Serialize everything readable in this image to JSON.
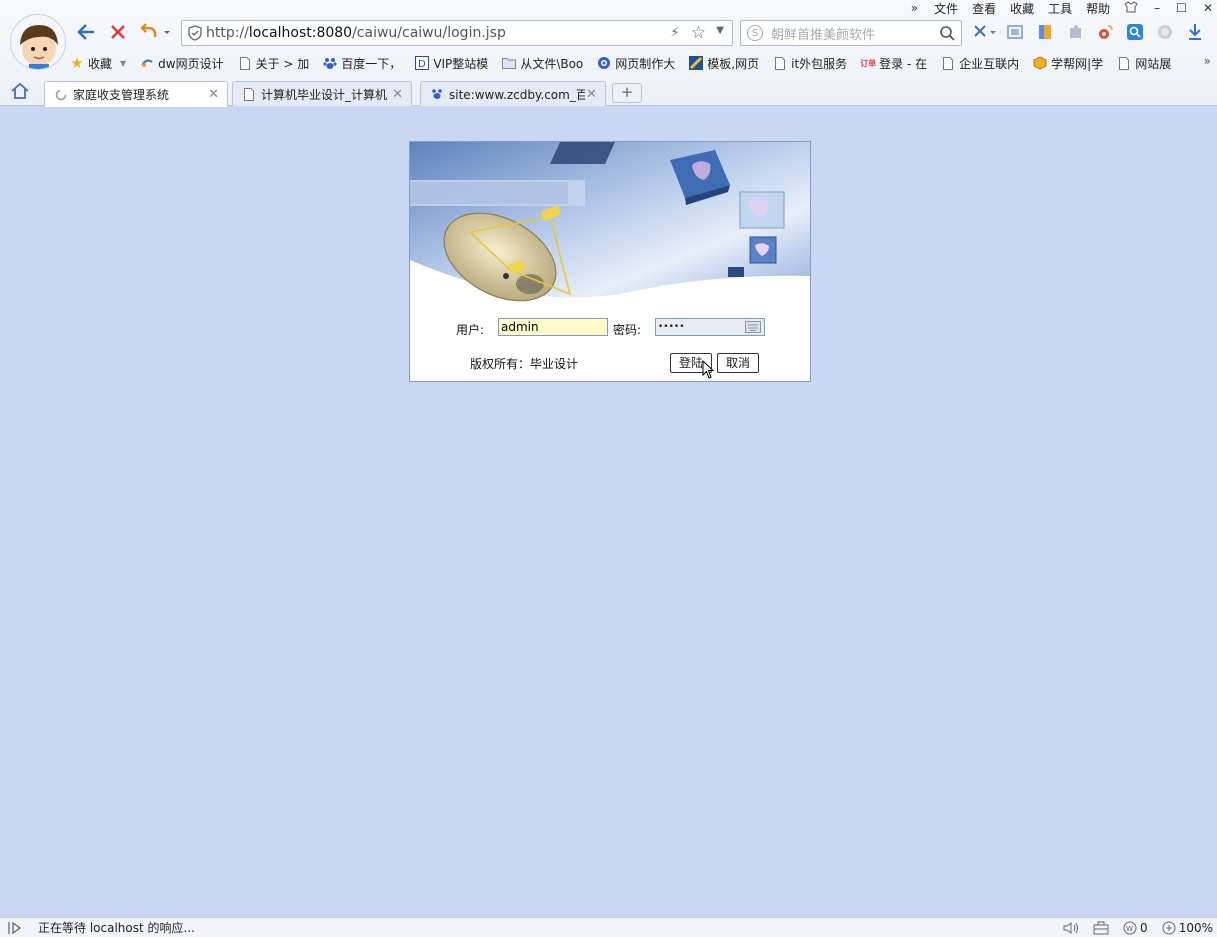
{
  "browser": {
    "menu": [
      "文件",
      "查看",
      "收藏",
      "工具",
      "帮助"
    ],
    "address": {
      "prefix": "http://",
      "host": "localhost:8080",
      "path": "/caiwu/caiwu/login.jsp"
    },
    "search_placeholder": "朝鲜首推美颜软件",
    "bookmarks": [
      {
        "label": "收藏",
        "icon": "star-icon"
      },
      {
        "label": "dw网页设计",
        "icon": "link-icon"
      },
      {
        "label": "关于 > 加",
        "icon": "page-icon"
      },
      {
        "label": "百度一下，",
        "icon": "baidu-paw-icon"
      },
      {
        "label": "VIP整站模",
        "icon": "vip-icon"
      },
      {
        "label": "从文件\\Boo",
        "icon": "folder-icon"
      },
      {
        "label": "网页制作大",
        "icon": "globe-icon"
      },
      {
        "label": "模板,网页",
        "icon": "template-icon"
      },
      {
        "label": "it外包服务",
        "icon": "page-icon"
      },
      {
        "label": "登录 - 在",
        "icon": "red-logo-icon"
      },
      {
        "label": "企业互联内",
        "icon": "page-icon"
      },
      {
        "label": "学帮网|学",
        "icon": "cube-icon"
      },
      {
        "label": "网站展",
        "icon": "page-icon"
      }
    ],
    "tabs": [
      {
        "label": "家庭收支管理系统",
        "active": true
      },
      {
        "label": "计算机毕业设计_计算机",
        "active": false
      },
      {
        "label": "site:www.zcdby.com_百",
        "active": false
      }
    ],
    "status_message": "正在等待 localhost 的响应...",
    "status_count": "0",
    "zoom": "100%"
  },
  "login": {
    "user_label": "用户:",
    "user_value": "admin",
    "password_label": "密码:",
    "password_mask": "•••••",
    "copyright": "版权所有：毕业设计",
    "login_button": "登陆",
    "cancel_button": "取消"
  },
  "colors": {
    "page_bg": "#c9d7f2",
    "user_input_bg": "#fffbc8",
    "password_input_bg": "#e8ecf2"
  }
}
